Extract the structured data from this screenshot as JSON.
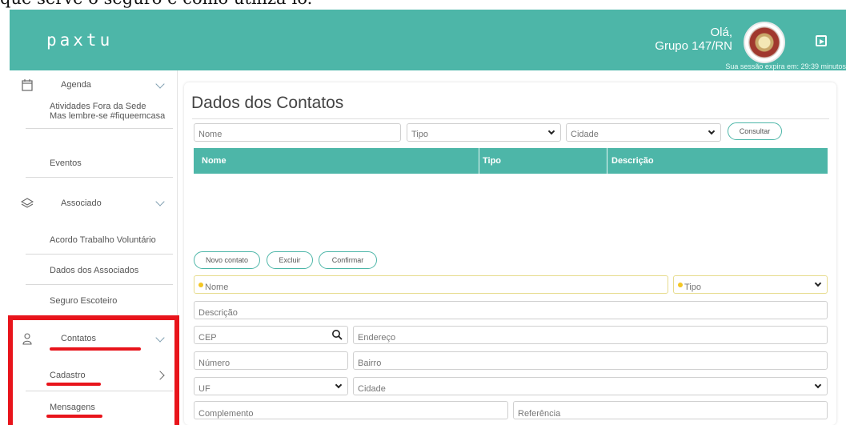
{
  "doc_fragment": "que serve o seguro e como utiliza-lo.",
  "header": {
    "logo": "paxtu",
    "greeting_line1": "Olá,",
    "greeting_line2": "Grupo 147/RN",
    "session": "Sua sessão expira em: 29:39 minutos",
    "logout_icon": "logout-icon"
  },
  "sidebar": {
    "agenda": "Agenda",
    "agenda_sub1": "Atividades Fora da Sede",
    "agenda_sub2": "Mas lembre-se #fiqueemcasa",
    "eventos": "Eventos",
    "associado": "Associado",
    "acordo": "Acordo Trabalho Voluntário",
    "dados_associados": "Dados dos Associados",
    "seguro": "Seguro Escoteiro",
    "contatos": "Contatos",
    "cadastro": "Cadastro",
    "mensagens": "Mensagens"
  },
  "colors": {
    "brand": "#4db6a8",
    "highlight": "#e8141b"
  },
  "main": {
    "title": "Dados dos Contatos",
    "filters": {
      "nome_ph": "Nome",
      "tipo_ph": "Tipo",
      "cidade_ph": "Cidade",
      "consultar": "Consultar"
    },
    "table": {
      "col_nome": "Nome",
      "col_tipo": "Tipo",
      "col_descricao": "Descrição"
    },
    "actions": {
      "novo": "Novo contato",
      "excluir": "Excluir",
      "confirmar": "Confirmar"
    },
    "form": {
      "nome": "Nome",
      "tipo": "Tipo",
      "descricao": "Descrição",
      "cep": "CEP",
      "endereco": "Endereço",
      "numero": "Número",
      "bairro": "Bairro",
      "uf": "UF",
      "cidade": "Cidade",
      "complemento": "Complemento",
      "referencia": "Referência"
    }
  }
}
